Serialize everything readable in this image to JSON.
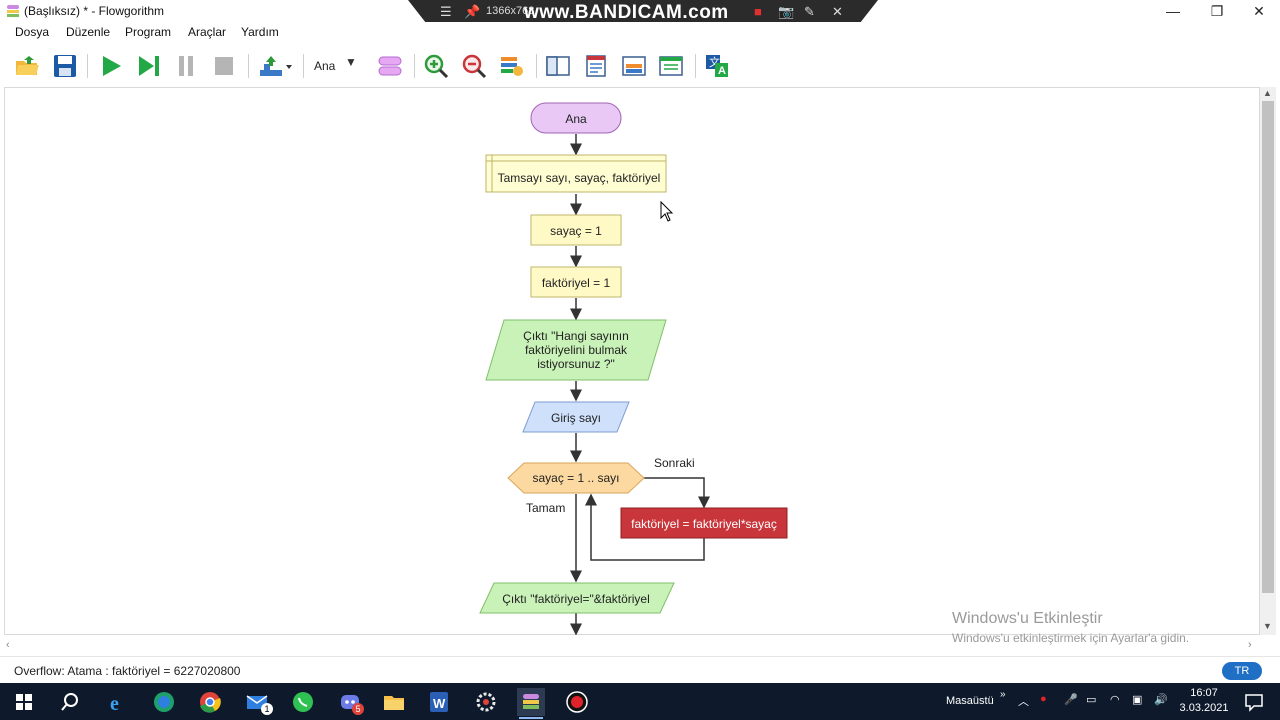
{
  "window": {
    "title": "(Başlıksız) * - Flowgorithm",
    "controls": {
      "minimize": "—",
      "restore": "❐",
      "close": "✕"
    }
  },
  "recorder": {
    "resolution": "1366x768",
    "logo": "www.BANDICAM.com"
  },
  "menu": [
    "Dosya",
    "Düzenle",
    "Program",
    "Araçlar",
    "Yardım"
  ],
  "toolbar": {
    "function_selector": "Ana",
    "icons": [
      "open-folder-icon",
      "save-icon",
      "run-icon",
      "step-icon",
      "pause-icon",
      "stop-icon",
      "speed-icon",
      "add-function-icon",
      "zoom-in-icon",
      "zoom-out-icon",
      "variables-icon",
      "layout-left-icon",
      "console-icon",
      "chart-icon",
      "source-view-icon",
      "translate-icon"
    ]
  },
  "flowchart": {
    "start_label": "Ana",
    "declare_label": "Tamsayı sayı, sayaç, faktöriyel",
    "assign1_label": "sayaç = 1",
    "assign2_label": "faktöriyel = 1",
    "output1_lines": [
      "Çıktı \"Hangi sayının",
      "faktöriyelini bulmak",
      "istiyorsunuz ?\""
    ],
    "input_label": "Giriş sayı",
    "loop_label": "sayaç = 1 .. sayı",
    "loop_next_label": "Sonraki",
    "loop_done_label": "Tamam",
    "loop_body_label": "faktöriyel = faktöriyel*sayaç",
    "output2_label": "Çıktı \"faktöriyel=\"&faktöriyel",
    "colors": {
      "terminal": "#e9c8f5",
      "declare": "#fffdd2",
      "assign": "#fffac5",
      "output": "#c9f2b8",
      "input": "#cfe0fb",
      "loop": "#fcd9a0",
      "body": "#c8353a"
    }
  },
  "watermark": {
    "line1": "Windows'u Etkinleştir",
    "line2": "Windows'u etkinleştirmek için Ayarlar'a gidin."
  },
  "status": {
    "message": "Overflow: Atama :  faktöriyel = 6227020800",
    "language": "TR"
  },
  "taskbar": {
    "apps": [
      "windows-start-icon",
      "search-icon",
      "ie-icon",
      "edge-icon",
      "chrome-icon",
      "mail-icon",
      "whatsapp-icon",
      "discord-icon",
      "file-explorer-icon",
      "word-icon",
      "settings-app-icon",
      "flowgorithm-icon",
      "record-icon"
    ],
    "badges": {
      "mail": "1",
      "discord": "5"
    },
    "desktop_label": "Masaüstü",
    "time": "16:07",
    "date": "3.03.2021"
  }
}
